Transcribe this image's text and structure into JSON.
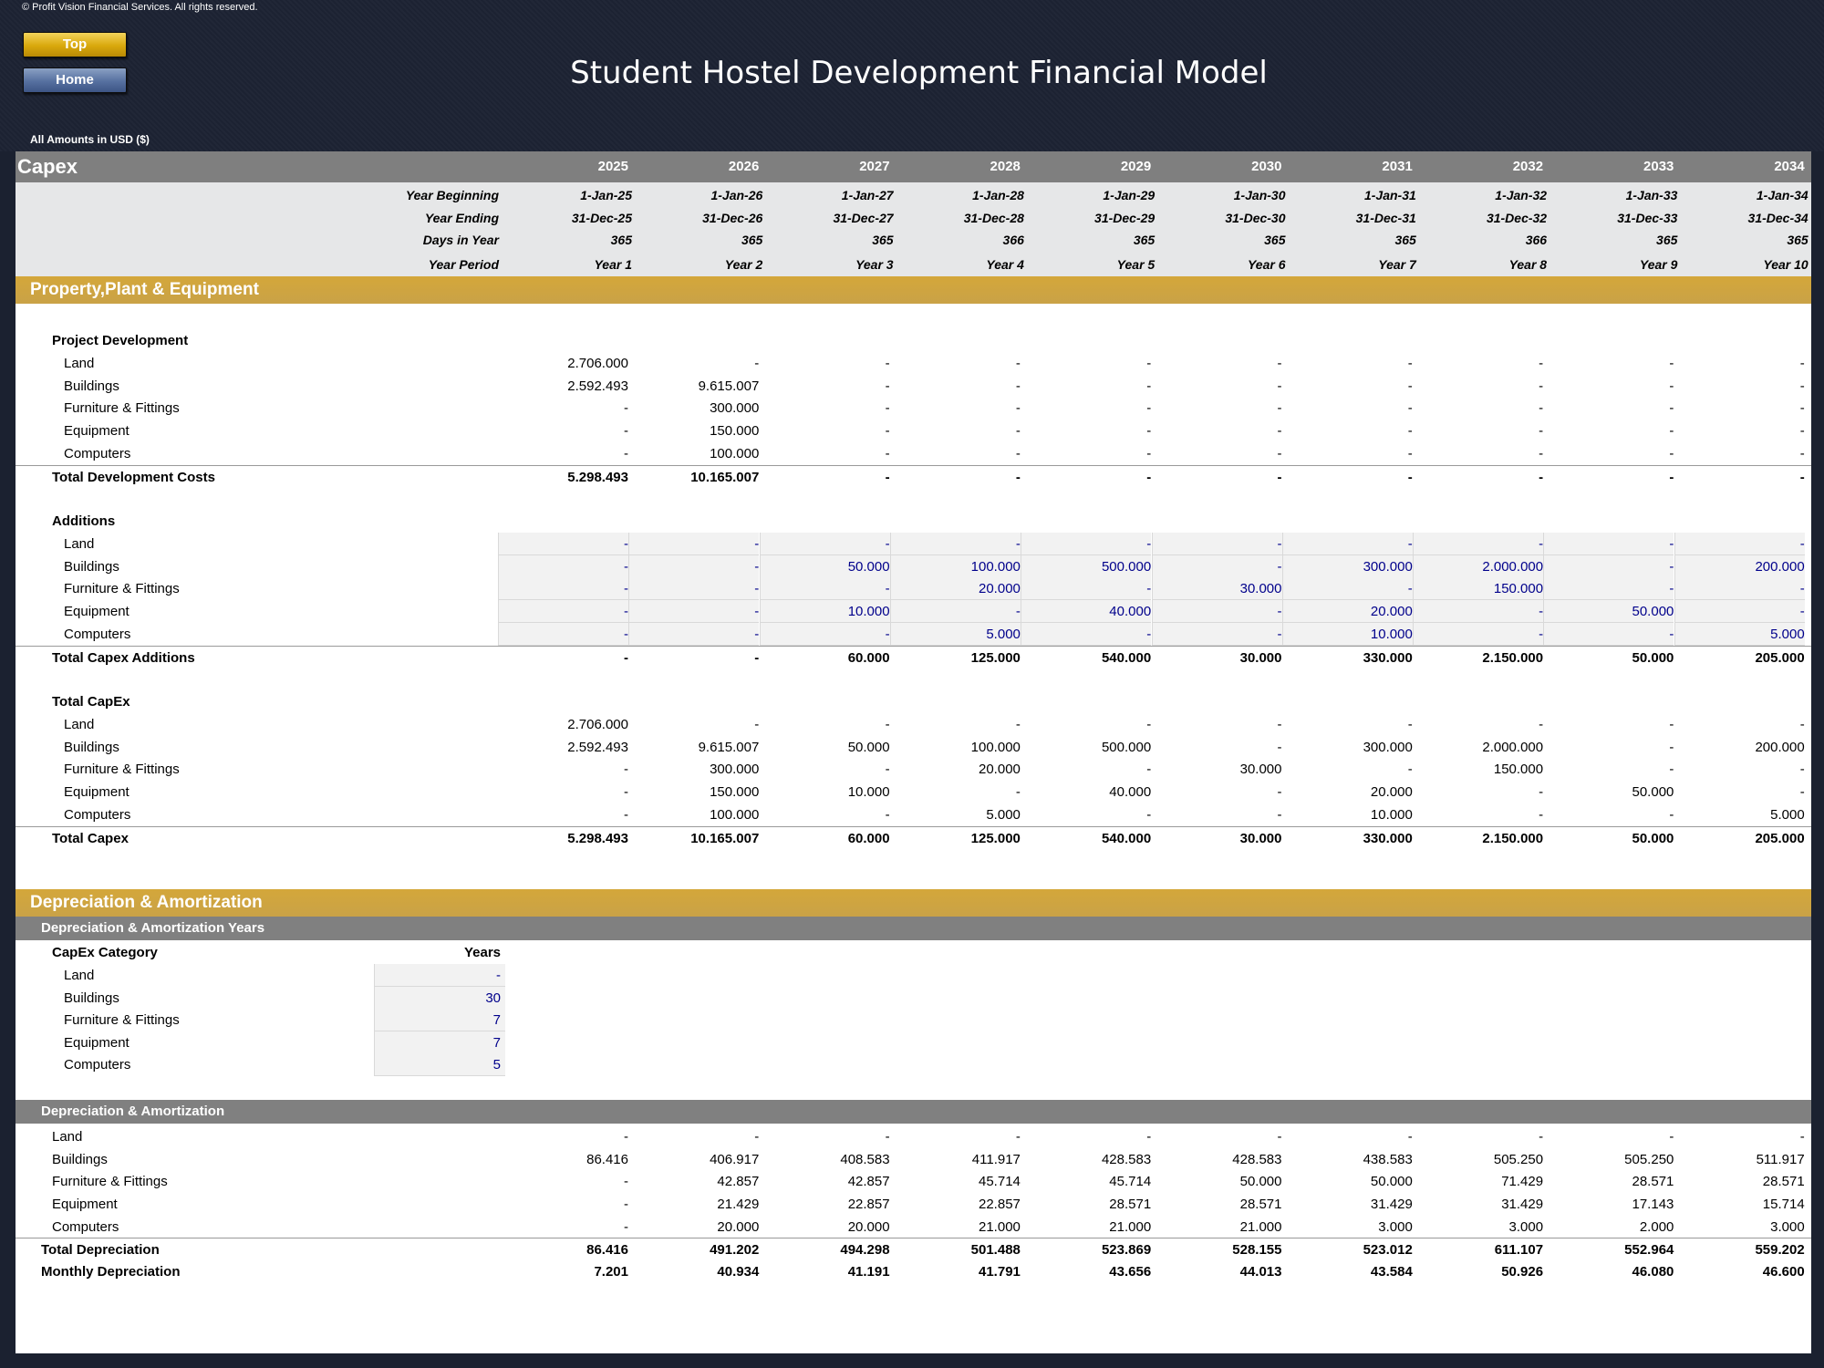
{
  "header": {
    "copyright": "© Profit Vision Financial Services. All rights reserved.",
    "top_button": "Top",
    "home_button": "Home",
    "title": "Student Hostel Development Financial Model",
    "amounts_label": "All Amounts in  USD ($)"
  },
  "capex_header": {
    "label": "Capex",
    "years": [
      "2025",
      "2026",
      "2027",
      "2028",
      "2029",
      "2030",
      "2031",
      "2032",
      "2033",
      "2034"
    ],
    "year_beginning_label": "Year Beginning",
    "year_beginning": [
      "1-Jan-25",
      "1-Jan-26",
      "1-Jan-27",
      "1-Jan-28",
      "1-Jan-29",
      "1-Jan-30",
      "1-Jan-31",
      "1-Jan-32",
      "1-Jan-33",
      "1-Jan-34"
    ],
    "year_ending_label": "Year Ending",
    "year_ending": [
      "31-Dec-25",
      "31-Dec-26",
      "31-Dec-27",
      "31-Dec-28",
      "31-Dec-29",
      "31-Dec-30",
      "31-Dec-31",
      "31-Dec-32",
      "31-Dec-33",
      "31-Dec-34"
    ],
    "days_label": "Days in Year",
    "days": [
      "365",
      "365",
      "365",
      "366",
      "365",
      "365",
      "365",
      "366",
      "365",
      "365"
    ],
    "period_label": "Year Period",
    "period": [
      "Year 1",
      "Year 2",
      "Year 3",
      "Year 4",
      "Year 5",
      "Year 6",
      "Year 7",
      "Year 8",
      "Year 9",
      "Year 10"
    ]
  },
  "ppe": {
    "section_title": "Property,Plant & Equipment",
    "project_dev_title": "Project Development",
    "project_dev_rows": [
      {
        "label": "Land",
        "values": [
          "2.706.000",
          "-",
          "-",
          "-",
          "-",
          "-",
          "-",
          "-",
          "-",
          "-"
        ]
      },
      {
        "label": "Buildings",
        "values": [
          "2.592.493",
          "9.615.007",
          "-",
          "-",
          "-",
          "-",
          "-",
          "-",
          "-",
          "-"
        ]
      },
      {
        "label": "Furniture & Fittings",
        "values": [
          "-",
          "300.000",
          "-",
          "-",
          "-",
          "-",
          "-",
          "-",
          "-",
          "-"
        ]
      },
      {
        "label": "Equipment",
        "values": [
          "-",
          "150.000",
          "-",
          "-",
          "-",
          "-",
          "-",
          "-",
          "-",
          "-"
        ]
      },
      {
        "label": "Computers",
        "values": [
          "-",
          "100.000",
          "-",
          "-",
          "-",
          "-",
          "-",
          "-",
          "-",
          "-"
        ]
      }
    ],
    "project_dev_total": {
      "label": "Total Development Costs",
      "values": [
        "5.298.493",
        "10.165.007",
        "-",
        "-",
        "-",
        "-",
        "-",
        "-",
        "-",
        "-"
      ]
    },
    "additions_title": "Additions",
    "additions_rows": [
      {
        "label": "Land",
        "values": [
          "-",
          "-",
          "-",
          "-",
          "-",
          "-",
          "-",
          "-",
          "-",
          "-"
        ]
      },
      {
        "label": "Buildings",
        "values": [
          "-",
          "-",
          "50.000",
          "100.000",
          "500.000",
          "-",
          "300.000",
          "2.000.000",
          "-",
          "200.000"
        ]
      },
      {
        "label": "Furniture & Fittings",
        "values": [
          "-",
          "-",
          "-",
          "20.000",
          "-",
          "30.000",
          "-",
          "150.000",
          "-",
          "-"
        ]
      },
      {
        "label": "Equipment",
        "values": [
          "-",
          "-",
          "10.000",
          "-",
          "40.000",
          "-",
          "20.000",
          "-",
          "50.000",
          "-"
        ]
      },
      {
        "label": "Computers",
        "values": [
          "-",
          "-",
          "-",
          "5.000",
          "-",
          "-",
          "10.000",
          "-",
          "-",
          "5.000"
        ]
      }
    ],
    "additions_total": {
      "label": "Total Capex Additions",
      "values": [
        "-",
        "-",
        "60.000",
        "125.000",
        "540.000",
        "30.000",
        "330.000",
        "2.150.000",
        "50.000",
        "205.000"
      ]
    },
    "total_capex_title": "Total CapEx",
    "total_capex_rows": [
      {
        "label": "Land",
        "values": [
          "2.706.000",
          "-",
          "-",
          "-",
          "-",
          "-",
          "-",
          "-",
          "-",
          "-"
        ]
      },
      {
        "label": "Buildings",
        "values": [
          "2.592.493",
          "9.615.007",
          "50.000",
          "100.000",
          "500.000",
          "-",
          "300.000",
          "2.000.000",
          "-",
          "200.000"
        ]
      },
      {
        "label": "Furniture & Fittings",
        "values": [
          "-",
          "300.000",
          "-",
          "20.000",
          "-",
          "30.000",
          "-",
          "150.000",
          "-",
          "-"
        ]
      },
      {
        "label": "Equipment",
        "values": [
          "-",
          "150.000",
          "10.000",
          "-",
          "40.000",
          "-",
          "20.000",
          "-",
          "50.000",
          "-"
        ]
      },
      {
        "label": "Computers",
        "values": [
          "-",
          "100.000",
          "-",
          "5.000",
          "-",
          "-",
          "10.000",
          "-",
          "-",
          "5.000"
        ]
      }
    ],
    "total_capex_total": {
      "label": "Total Capex",
      "values": [
        "5.298.493",
        "10.165.007",
        "60.000",
        "125.000",
        "540.000",
        "30.000",
        "330.000",
        "2.150.000",
        "50.000",
        "205.000"
      ]
    }
  },
  "da": {
    "section_title": "Depreciation & Amortization",
    "years_subtitle": "Depreciation & Amortization Years",
    "category_label": "CapEx Category",
    "years_label": "Years",
    "years_rows": [
      {
        "label": "Land",
        "value": "-"
      },
      {
        "label": "Buildings",
        "value": "30"
      },
      {
        "label": "Furniture & Fittings",
        "value": "7"
      },
      {
        "label": "Equipment",
        "value": "7"
      },
      {
        "label": "Computers",
        "value": "5"
      }
    ],
    "schedule_subtitle": "Depreciation & Amortization",
    "schedule_rows": [
      {
        "label": "Land",
        "values": [
          "-",
          "-",
          "-",
          "-",
          "-",
          "-",
          "-",
          "-",
          "-",
          "-"
        ]
      },
      {
        "label": "Buildings",
        "values": [
          "86.416",
          "406.917",
          "408.583",
          "411.917",
          "428.583",
          "428.583",
          "438.583",
          "505.250",
          "505.250",
          "511.917"
        ]
      },
      {
        "label": "Furniture & Fittings",
        "values": [
          "-",
          "42.857",
          "42.857",
          "45.714",
          "45.714",
          "50.000",
          "50.000",
          "71.429",
          "28.571",
          "28.571"
        ]
      },
      {
        "label": "Equipment",
        "values": [
          "-",
          "21.429",
          "22.857",
          "22.857",
          "28.571",
          "28.571",
          "31.429",
          "31.429",
          "17.143",
          "15.714"
        ]
      },
      {
        "label": "Computers",
        "values": [
          "-",
          "20.000",
          "20.000",
          "21.000",
          "21.000",
          "21.000",
          "3.000",
          "3.000",
          "2.000",
          "3.000"
        ]
      }
    ],
    "total_row": {
      "label": "Total Depreciation",
      "values": [
        "86.416",
        "491.202",
        "494.298",
        "501.488",
        "523.869",
        "528.155",
        "523.012",
        "611.107",
        "552.964",
        "559.202"
      ]
    },
    "monthly_row": {
      "label": "Monthly Depreciation",
      "values": [
        "7.201",
        "40.934",
        "41.191",
        "41.791",
        "43.656",
        "44.013",
        "43.584",
        "50.926",
        "46.080",
        "46.600"
      ]
    }
  }
}
